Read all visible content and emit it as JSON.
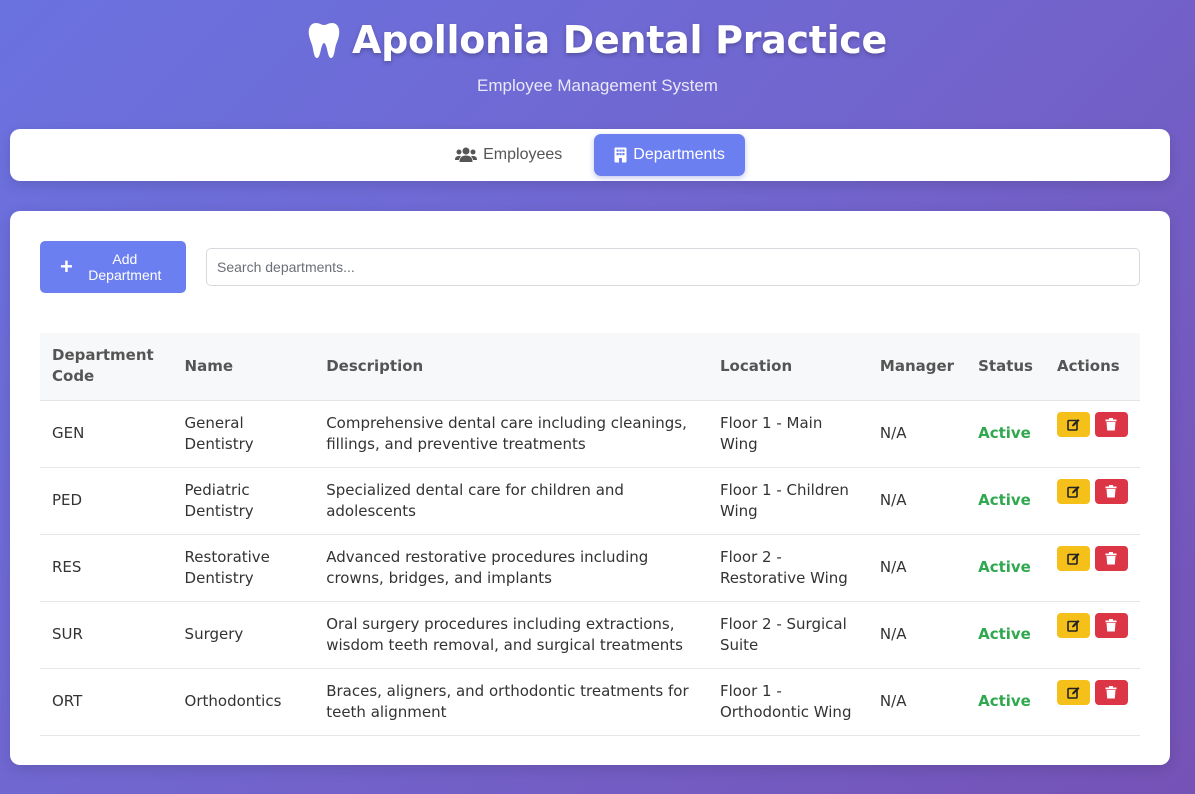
{
  "header": {
    "title": "Apollonia Dental Practice",
    "subtitle": "Employee Management System"
  },
  "nav": {
    "tabs": [
      {
        "label": "Employees",
        "icon": "users-icon",
        "active": false
      },
      {
        "label": "Departments",
        "icon": "building-icon",
        "active": true
      }
    ]
  },
  "toolbar": {
    "add_label": "Add Department",
    "search_placeholder": "Search departments..."
  },
  "table": {
    "columns": [
      "Department Code",
      "Name",
      "Description",
      "Location",
      "Manager",
      "Status",
      "Actions"
    ],
    "rows": [
      {
        "code": "GEN",
        "name": "General Dentistry",
        "description": "Comprehensive dental care including cleanings, fillings, and preventive treatments",
        "location": "Floor 1 - Main Wing",
        "manager": "N/A",
        "status": "Active"
      },
      {
        "code": "PED",
        "name": "Pediatric Dentistry",
        "description": "Specialized dental care for children and adolescents",
        "location": "Floor 1 - Children Wing",
        "manager": "N/A",
        "status": "Active"
      },
      {
        "code": "RES",
        "name": "Restorative Dentistry",
        "description": "Advanced restorative procedures including crowns, bridges, and implants",
        "location": "Floor 2 - Restorative Wing",
        "manager": "N/A",
        "status": "Active"
      },
      {
        "code": "SUR",
        "name": "Surgery",
        "description": "Oral surgery procedures including extractions, wisdom teeth removal, and surgical treatments",
        "location": "Floor 2 - Surgical Suite",
        "manager": "N/A",
        "status": "Active"
      },
      {
        "code": "ORT",
        "name": "Orthodontics",
        "description": "Braces, aligners, and orthodontic treatments for teeth alignment",
        "location": "Floor 1 - Orthodontic Wing",
        "manager": "N/A",
        "status": "Active"
      }
    ]
  },
  "colors": {
    "accent": "#6b7ff0",
    "status_active": "#2fa84f",
    "edit": "#f5c01a",
    "delete": "#dc3545"
  }
}
